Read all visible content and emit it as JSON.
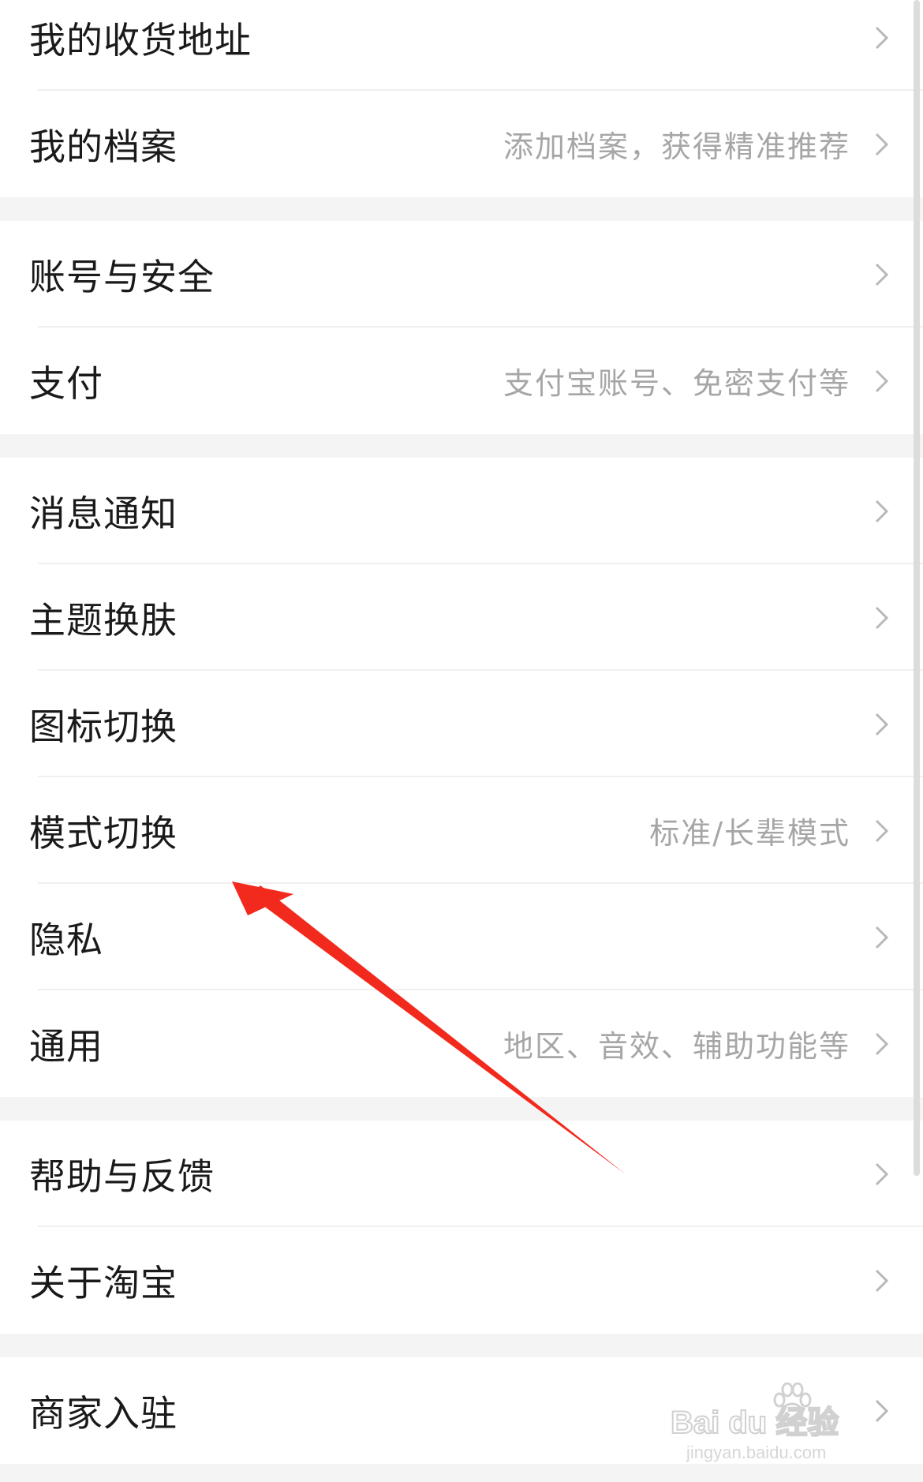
{
  "groups": [
    {
      "items": [
        {
          "label": "我的收货地址",
          "hint": ""
        },
        {
          "label": "我的档案",
          "hint": "添加档案，获得精准推荐"
        }
      ]
    },
    {
      "items": [
        {
          "label": "账号与安全",
          "hint": ""
        },
        {
          "label": "支付",
          "hint": "支付宝账号、免密支付等"
        }
      ]
    },
    {
      "items": [
        {
          "label": "消息通知",
          "hint": ""
        },
        {
          "label": "主题换肤",
          "hint": ""
        },
        {
          "label": "图标切换",
          "hint": ""
        },
        {
          "label": "模式切换",
          "hint": "标准/长辈模式"
        },
        {
          "label": "隐私",
          "hint": ""
        },
        {
          "label": "通用",
          "hint": "地区、音效、辅助功能等"
        }
      ]
    },
    {
      "items": [
        {
          "label": "帮助与反馈",
          "hint": ""
        },
        {
          "label": "关于淘宝",
          "hint": ""
        }
      ]
    },
    {
      "items": [
        {
          "label": "商家入驻",
          "hint": ""
        }
      ]
    }
  ],
  "icons": {
    "chevron": "chevron-right-icon",
    "annotation": "red-arrow-annotation"
  },
  "colors": {
    "background": "#f4f4f4",
    "row": "#ffffff",
    "title": "#1a1a1a",
    "hint": "#a6a6a6",
    "chevron": "#b8b8b8",
    "arrow": "#f22a1e"
  },
  "watermark": {
    "brand": "Bai du 经验",
    "site": "jingyan.baidu.com"
  }
}
